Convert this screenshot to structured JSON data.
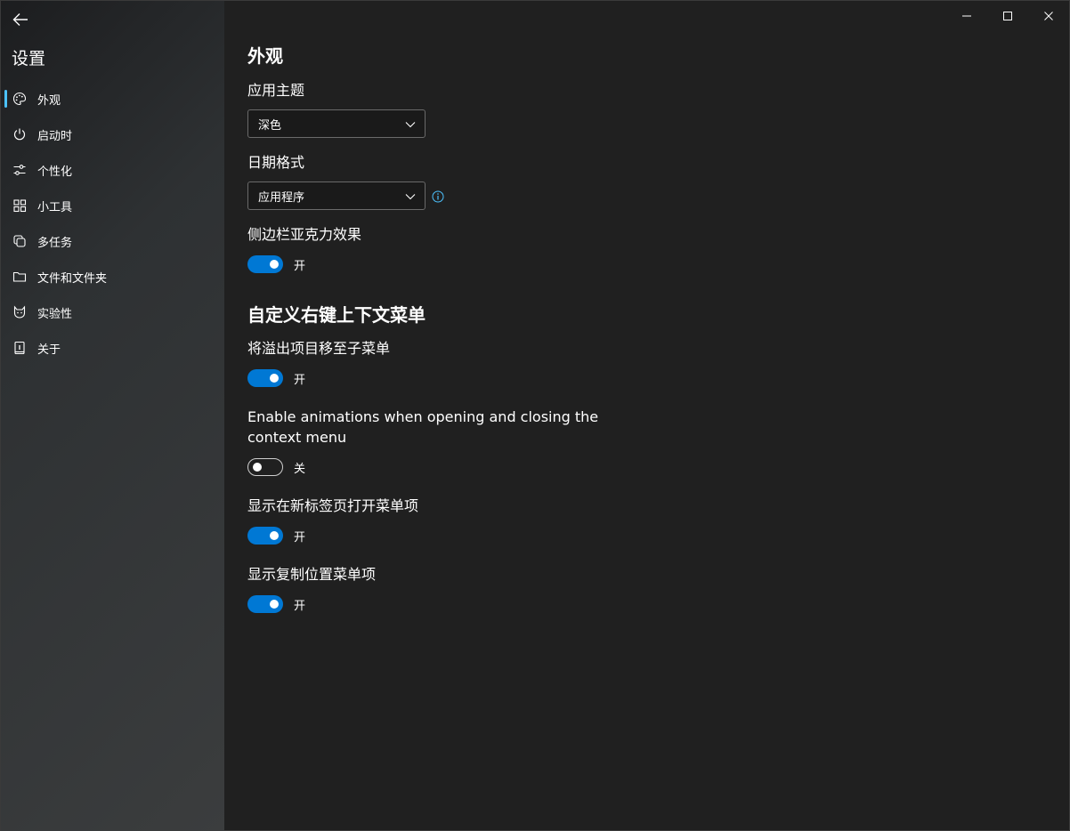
{
  "sidebar": {
    "title": "设置",
    "items": [
      {
        "label": "外观",
        "icon": "palette-icon",
        "selected": true
      },
      {
        "label": "启动时",
        "icon": "power-icon",
        "selected": false
      },
      {
        "label": "个性化",
        "icon": "sliders-icon",
        "selected": false
      },
      {
        "label": "小工具",
        "icon": "widgets-icon",
        "selected": false
      },
      {
        "label": "多任务",
        "icon": "multitask-icon",
        "selected": false
      },
      {
        "label": "文件和文件夹",
        "icon": "folder-icon",
        "selected": false
      },
      {
        "label": "实验性",
        "icon": "cat-icon",
        "selected": false
      },
      {
        "label": "关于",
        "icon": "about-icon",
        "selected": false
      }
    ]
  },
  "main": {
    "title": "外观",
    "theme": {
      "label": "应用主题",
      "value": "深色"
    },
    "date_format": {
      "label": "日期格式",
      "value": "应用程序"
    },
    "acrylic": {
      "label": "侧边栏亚克力效果",
      "state": "开",
      "on": true
    },
    "context_menu": {
      "title": "自定义右键上下文菜单",
      "overflow": {
        "label": "将溢出项目移至子菜单",
        "state": "开",
        "on": true
      },
      "animations": {
        "label": "Enable animations when opening and closing the context menu",
        "state": "关",
        "on": false
      },
      "new_tab": {
        "label": "显示在新标签页打开菜单项",
        "state": "开",
        "on": true
      },
      "copy_location": {
        "label": "显示复制位置菜单项",
        "state": "开",
        "on": true
      }
    }
  },
  "colors": {
    "accent": "#0078d4",
    "background": "#202020",
    "indicator": "#4cc2ff"
  }
}
